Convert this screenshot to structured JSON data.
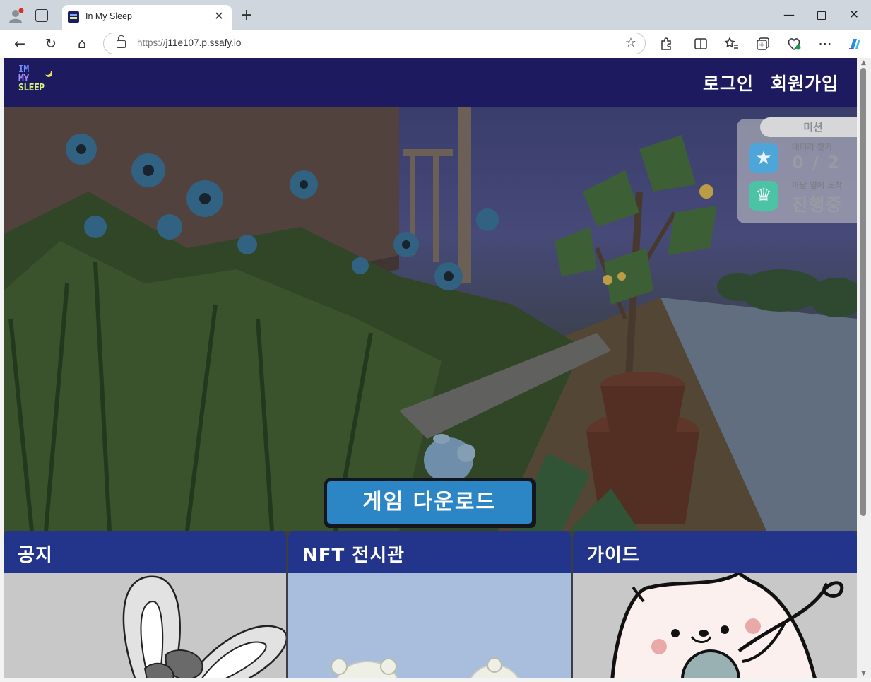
{
  "browser": {
    "tab_title": "In My Sleep",
    "tab_close": "✕",
    "new_tab": "+",
    "url_scheme": "https://",
    "url_host": "j11e107.p.ssafy.io",
    "window": {
      "minimize": "—",
      "maximize": "",
      "close": "✕"
    },
    "toolbar": {
      "back": "←",
      "refresh": "↻",
      "home": "⌂",
      "favorite": "☆"
    }
  },
  "site": {
    "logo": {
      "line1": "IM",
      "line2": "MY",
      "line3": "SLEEP"
    },
    "nav": {
      "login": "로그인",
      "signup": "회원가입"
    }
  },
  "hero": {
    "mission_panel": {
      "title": "미션",
      "items": [
        {
          "label": "배터리 찾기",
          "value": "0 / 2",
          "icon": "star-icon"
        },
        {
          "label": "마당 옆에 도착",
          "value": "진행중",
          "icon": "crown-icon"
        }
      ]
    },
    "download_button": "게임 다운로드"
  },
  "cards": [
    {
      "title": "공지"
    },
    {
      "title": "NFT 전시관"
    },
    {
      "title": "가이드"
    }
  ],
  "colors": {
    "header_bg": "#1e1a5f",
    "card_head_bg": "#22358a",
    "download_btn": "#2c85c4"
  }
}
